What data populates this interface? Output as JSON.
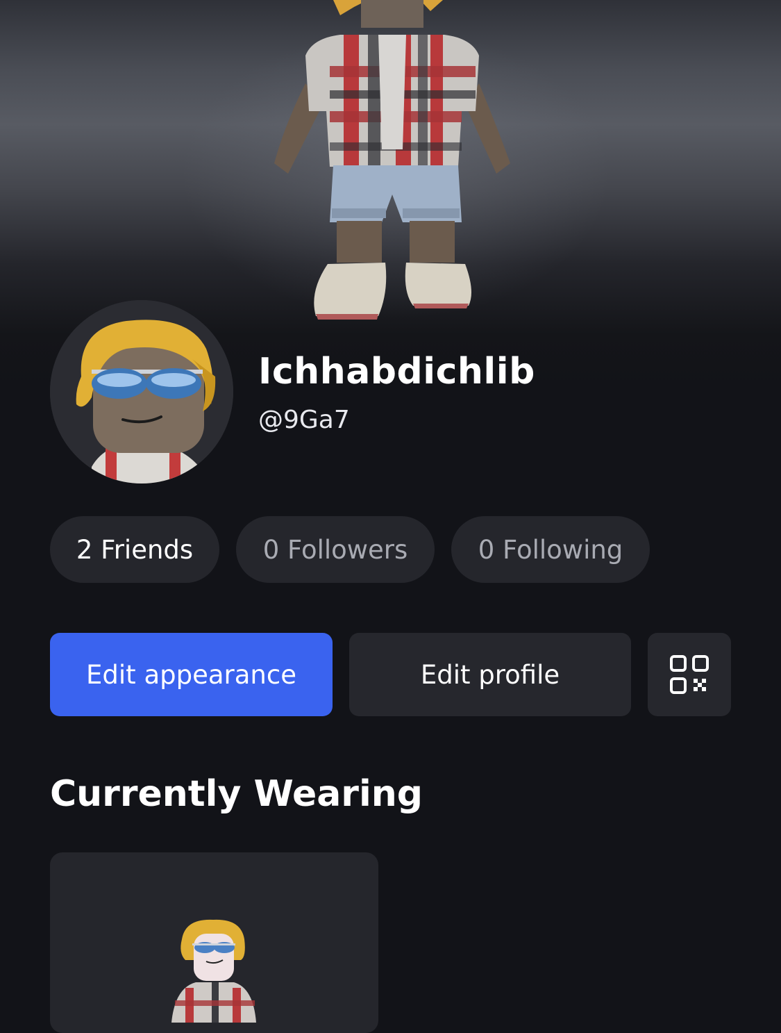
{
  "profile": {
    "display_name": "Ichhabdichlib",
    "username": "@9Ga7"
  },
  "stats": {
    "friends": "2 Friends",
    "followers": "0 Followers",
    "following": "0 Following"
  },
  "actions": {
    "edit_appearance": "Edit appearance",
    "edit_profile": "Edit profile",
    "qr_icon": "qr-code-icon"
  },
  "wearing": {
    "title": "Currently Wearing"
  },
  "colors": {
    "background": "#121318",
    "pill": "#25262c",
    "accent": "#3a63ef",
    "muted_text": "#a9abb3"
  }
}
